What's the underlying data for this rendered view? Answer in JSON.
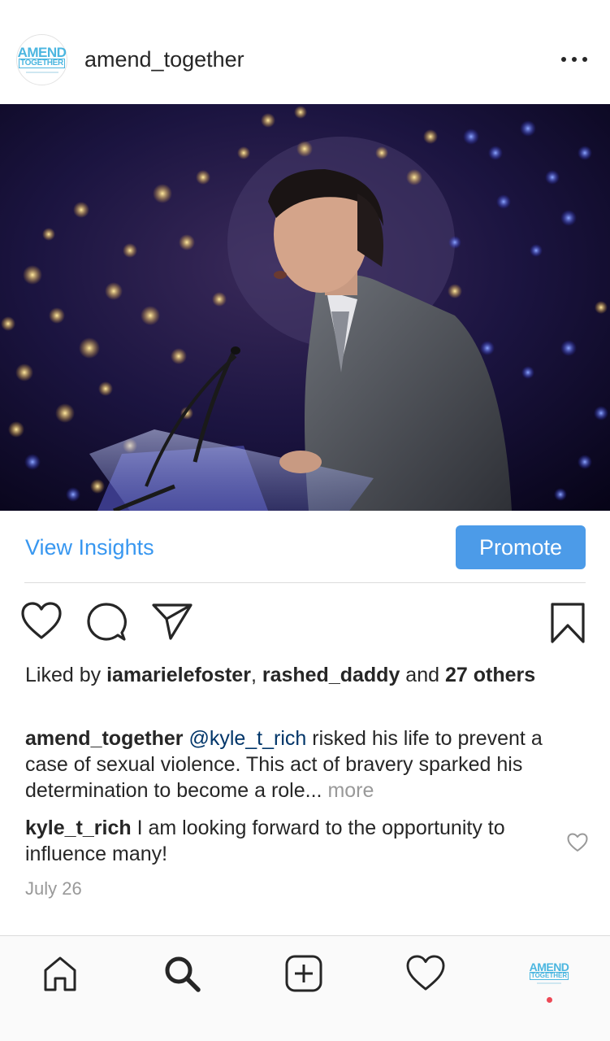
{
  "post": {
    "username": "amend_together",
    "avatar_text_top": "AMEND",
    "avatar_text_bottom": "TOGETHER",
    "photo_alt": "Man in grey suit speaking at a clear podium on stage"
  },
  "insights": {
    "view_insights_label": "View Insights",
    "promote_label": "Promote"
  },
  "likes": {
    "prefix": "Liked by ",
    "user1": "iamarielefoster",
    "separator": ", ",
    "user2": "rashed_daddy",
    "and_text": " and ",
    "others": "27 others"
  },
  "caption": {
    "username": "amend_together",
    "mention": "@kyle_t_rich",
    "text": " risked his life to prevent a case of sexual violence. This act of bravery sparked his determination to become a role...",
    "more": "more"
  },
  "comment": {
    "username": "kyle_t_rich",
    "text": " I am looking forward to the opportunity to influence many!"
  },
  "timestamp": "July 26",
  "icons": {
    "like": "heart-icon",
    "comment": "comment-icon",
    "share": "paper-plane-icon",
    "bookmark": "bookmark-icon",
    "home": "home-icon",
    "search": "search-icon",
    "add": "add-post-icon",
    "activity": "heart-icon"
  },
  "colors": {
    "link_blue": "#3897f0",
    "promote_blue": "#4c9be8",
    "mention": "#003569",
    "notification": "#ed4956"
  }
}
